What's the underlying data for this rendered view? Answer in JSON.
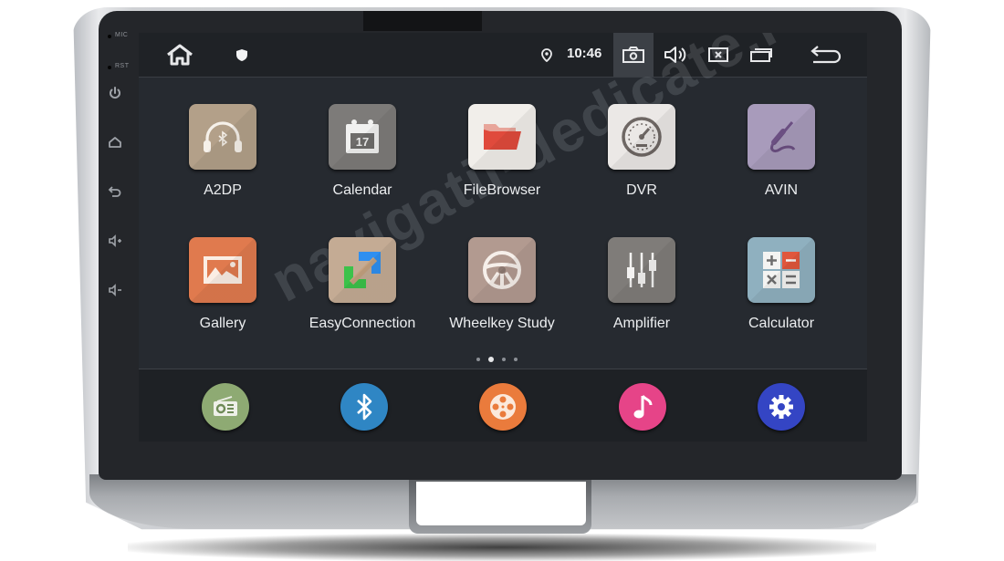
{
  "device": {
    "side_labels": {
      "mic": "MIC",
      "rst": "RST"
    },
    "side_buttons": [
      {
        "name": "power",
        "icon": "power-icon"
      },
      {
        "name": "home",
        "icon": "home-icon"
      },
      {
        "name": "back",
        "icon": "back-icon"
      },
      {
        "name": "volume-up",
        "icon": "volume-up-icon"
      },
      {
        "name": "volume-down",
        "icon": "volume-down-icon"
      }
    ]
  },
  "statusbar": {
    "left_icons": [
      "home-icon",
      "shield-icon"
    ],
    "time": "10:46",
    "right_icons": [
      "location-icon",
      "camera-icon",
      "volume-icon",
      "close-box-icon",
      "recent-apps-icon",
      "back-icon"
    ]
  },
  "apps": [
    {
      "label": "A2DP",
      "icon": "bluetooth-headphones-icon",
      "color": "#b3a089"
    },
    {
      "label": "Calendar",
      "icon": "calendar-icon",
      "color": "#7d7b79",
      "day": "17"
    },
    {
      "label": "FileBrowser",
      "icon": "folder-icon",
      "color": "#f1eeea"
    },
    {
      "label": "DVR",
      "icon": "speedometer-icon",
      "color": "#ebe8e6"
    },
    {
      "label": "AVIN",
      "icon": "audio-jack-icon",
      "color": "#a89bbb"
    },
    {
      "label": "Gallery",
      "icon": "image-icon",
      "color": "#e07a4e"
    },
    {
      "label": "EasyConnection",
      "icon": "connection-icon",
      "color": "#c4ab94"
    },
    {
      "label": "Wheelkey Study",
      "icon": "steering-wheel-icon",
      "color": "#b29a90"
    },
    {
      "label": "Amplifier",
      "icon": "equalizer-icon",
      "color": "#7f7c79"
    },
    {
      "label": "Calculator",
      "icon": "calculator-icon",
      "color": "#8fb0bf"
    }
  ],
  "pager": {
    "count": 4,
    "active": 2
  },
  "dock": [
    {
      "name": "radio",
      "icon": "radio-icon",
      "color": "#8eaa73"
    },
    {
      "name": "bluetooth",
      "icon": "bluetooth-icon",
      "color": "#2f86c4"
    },
    {
      "name": "video",
      "icon": "film-reel-icon",
      "color": "#ea7b3c"
    },
    {
      "name": "music",
      "icon": "music-note-icon",
      "color": "#e64488"
    },
    {
      "name": "settings",
      "icon": "gear-icon",
      "color": "#3445c4"
    }
  ],
  "watermark": "navigatii-dedicate.ro"
}
